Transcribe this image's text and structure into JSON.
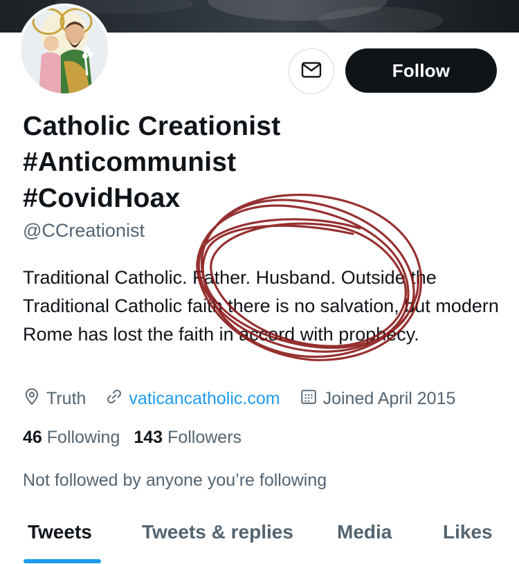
{
  "profile": {
    "name_lines": [
      "Catholic Creationist",
      "#Anticommunist",
      "#CovidHoax"
    ],
    "handle": "@CCreationist",
    "bio": "Traditional Catholic. Father. Husband. Outside the Traditional Catholic faith there is no salvation, but modern Rome has lost the faith in accord with prophecy.",
    "location": "Truth",
    "website": "vaticancatholic.com",
    "joined": "Joined April 2015",
    "following_count": "46",
    "following_label": "Following",
    "followers_count": "143",
    "followers_label": "Followers",
    "not_followed_text": "Not followed by anyone you’re following"
  },
  "actions": {
    "follow_label": "Follow",
    "message_icon": "envelope-icon"
  },
  "tabs": [
    {
      "label": "Tweets",
      "active": true
    },
    {
      "label": "Tweets & replies",
      "active": false
    },
    {
      "label": "Media",
      "active": false
    },
    {
      "label": "Likes",
      "active": false
    }
  ],
  "colors": {
    "accent": "#1d9bf0",
    "text": "#0f1419",
    "secondary": "#536471",
    "scribble": "#8b1a1a"
  }
}
